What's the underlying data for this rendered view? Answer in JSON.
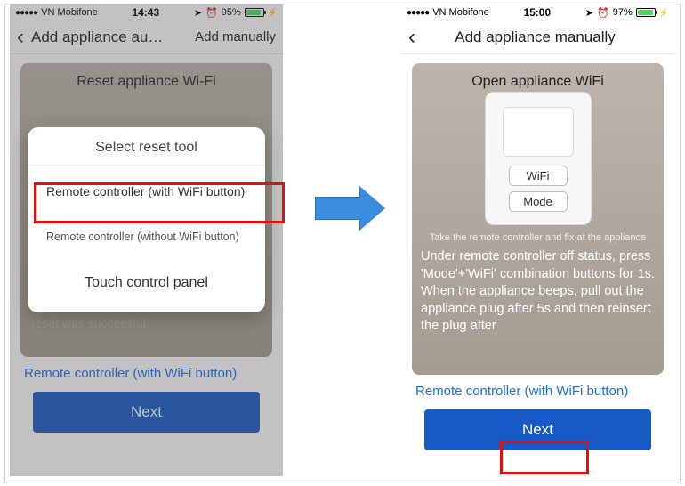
{
  "left": {
    "status": {
      "carrier": "VN Mobifone",
      "time": "14:43",
      "battery": "95%"
    },
    "nav": {
      "title": "Add appliance au…",
      "action": "Add manually"
    },
    "card": {
      "title": "Reset appliance Wi-Fi",
      "dim_text": "combination buttons for 1s. Once the appliance beeps, this indicates that the reset was successful."
    },
    "modal": {
      "title": "Select reset tool",
      "opt1": "Remote controller (with WiFi button)",
      "opt2": "Remote controller (without WiFi button)",
      "opt3": "Touch control panel"
    },
    "link": "Remote controller (with WiFi button)",
    "next": "Next"
  },
  "right": {
    "status": {
      "carrier": "VN Mobifone",
      "time": "15:00",
      "battery": "97%"
    },
    "nav": {
      "title": "Add appliance manually"
    },
    "card": {
      "title": "Open appliance WiFi",
      "btn_wifi": "WiFi",
      "btn_mode": "Mode",
      "hint": "Take the remote controller and fix at the appliance",
      "instr": "Under remote controller off status, press 'Mode'+'WiFi' combination buttons for 1s. When the appliance beeps, pull out the appliance plug after 5s and then reinsert the plug after"
    },
    "link": "Remote controller (with WiFi button)",
    "next": "Next"
  }
}
